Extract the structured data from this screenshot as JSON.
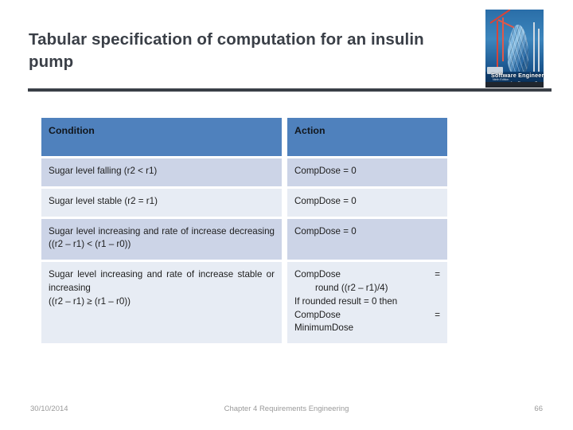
{
  "slide": {
    "title": "Tabular specification of computation for an insulin pump"
  },
  "book_cover": {
    "title": "Software Engineering",
    "edition": "Ninth Edition",
    "author": "Ian Sommerville"
  },
  "table": {
    "headers": {
      "condition": "Condition",
      "action": "Action"
    },
    "rows": [
      {
        "condition": "Sugar level falling (r2 < r1)",
        "action": "CompDose = 0",
        "shaded": true
      },
      {
        "condition": "Sugar level stable (r2 = r1)",
        "action": "CompDose = 0",
        "shaded": false
      },
      {
        "condition_main": "Sugar level increasing and rate of increase decreasing",
        "condition_last": "((r2 – r1) < (r1 – r0))",
        "action": "CompDose = 0",
        "shaded": true
      },
      {
        "condition_main": "Sugar level increasing and rate of increase stable or increasing",
        "condition_last": "((r2 – r1) ≥ (r1 – r0))",
        "action_line1": "CompDose =",
        "action_line2": "round ((r2 – r1)/4)",
        "action_line3": "If rounded result = 0 then",
        "action_line4": "CompDose =",
        "action_line5": "MinimumDose",
        "shaded": false
      }
    ]
  },
  "footer": {
    "date": "30/10/2014",
    "center": "Chapter 4 Requirements Engineering",
    "page": "66"
  },
  "colors": {
    "header_blue": "#4f81bd",
    "row_shaded": "#ccd4e7",
    "row_plain": "#e7ecf4",
    "rule_dark": "#3a3f47",
    "footer_gray": "#9a9a9a"
  }
}
